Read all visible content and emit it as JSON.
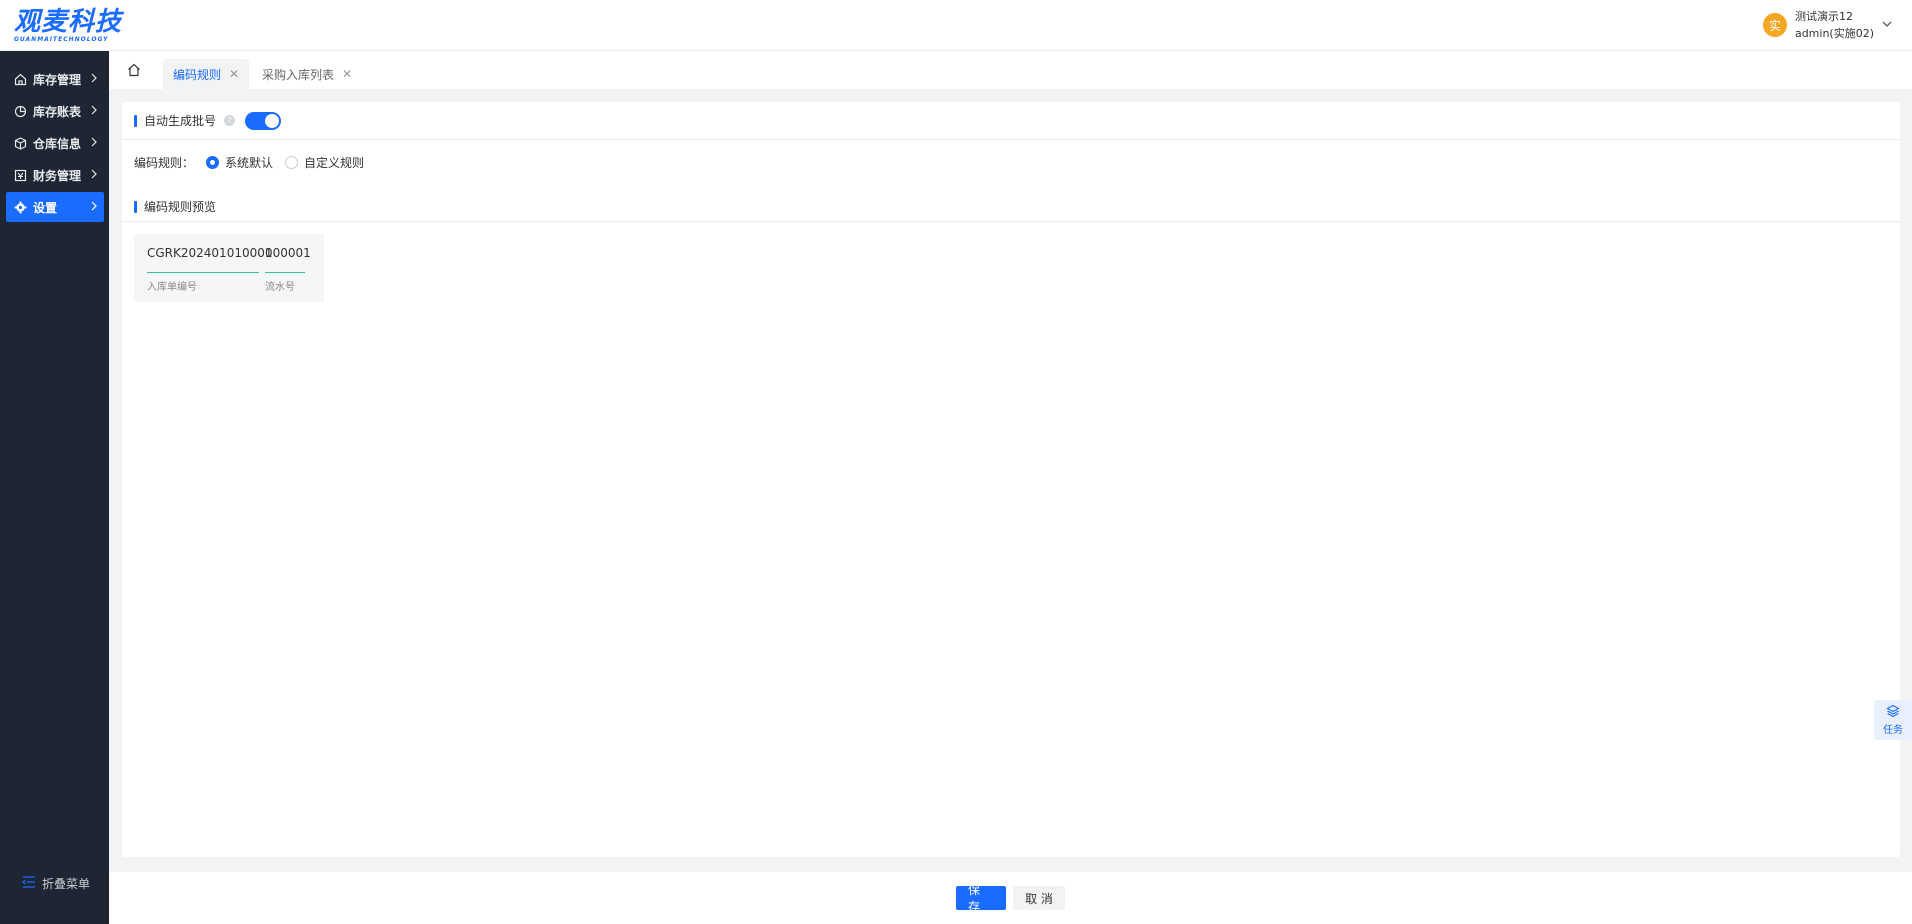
{
  "header": {
    "logo_text": "观麦科技",
    "logo_sub": "GUANMAITECHNOLOGY",
    "avatar_letter": "实",
    "user_name": "测试演示12",
    "user_account": "admin(实施02)"
  },
  "sidebar": {
    "items": [
      {
        "label": "库存管理",
        "icon": "home-icon"
      },
      {
        "label": "库存账表",
        "icon": "pie-chart-icon"
      },
      {
        "label": "仓库信息",
        "icon": "cube-icon"
      },
      {
        "label": "财务管理",
        "icon": "finance-icon"
      },
      {
        "label": "设置",
        "icon": "gear-icon"
      }
    ],
    "collapse_label": "折叠菜单"
  },
  "tabs": [
    {
      "label": "编码规则",
      "active": true
    },
    {
      "label": "采购入库列表",
      "active": false
    }
  ],
  "main": {
    "toggle_label": "自动生成批号",
    "toggle_on": true,
    "rule_label": "编码规则：",
    "rule_options": [
      "系统默认",
      "自定义规则"
    ],
    "rule_selected": "系统默认",
    "preview_title": "编码规则预览",
    "preview_segments": [
      {
        "value": "CGRK202401010001",
        "label": "入库单编号"
      },
      {
        "value": "000001",
        "label": "流水号"
      }
    ]
  },
  "footer": {
    "save_label": "保 存",
    "cancel_label": "取 消"
  },
  "float": {
    "task_label": "任务"
  },
  "colors": {
    "accent": "#1a6bff",
    "sidebar_bg": "#1f2633",
    "preview_line": "#37c192",
    "avatar": "#f5a623"
  }
}
